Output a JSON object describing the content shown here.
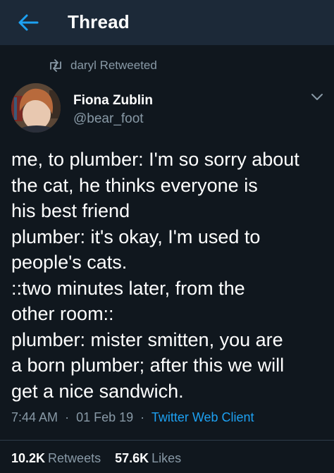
{
  "header": {
    "title": "Thread",
    "back_icon": "arrow-left-icon",
    "accent_color": "#1da1f2"
  },
  "retweet_context": {
    "icon": "retweet-icon",
    "text": "daryl Retweeted"
  },
  "tweet": {
    "author": {
      "name": "Fiona Zublin",
      "handle": "@bear_foot",
      "avatar_icon": "avatar"
    },
    "menu_icon": "chevron-down-icon",
    "lines": [
      "me, to plumber: I'm so sorry about",
      "the cat, he thinks everyone is",
      "his best friend",
      "plumber: it's okay, I'm used to",
      "people's cats.",
      "::two minutes later, from the",
      "other room::",
      "plumber: mister smitten, you are",
      "a born plumber; after this we will",
      "get a nice sandwich."
    ],
    "time": "7:44 AM",
    "date": "01 Feb 19",
    "separator": "·",
    "client": "Twitter Web Client"
  },
  "stats": {
    "retweets_count": "10.2K",
    "retweets_label": "Retweets",
    "likes_count": "57.6K",
    "likes_label": "Likes"
  },
  "colors": {
    "background": "#10171e",
    "header_bg": "#1c2938",
    "secondary_text": "#8899a6",
    "link": "#1da1f2"
  }
}
